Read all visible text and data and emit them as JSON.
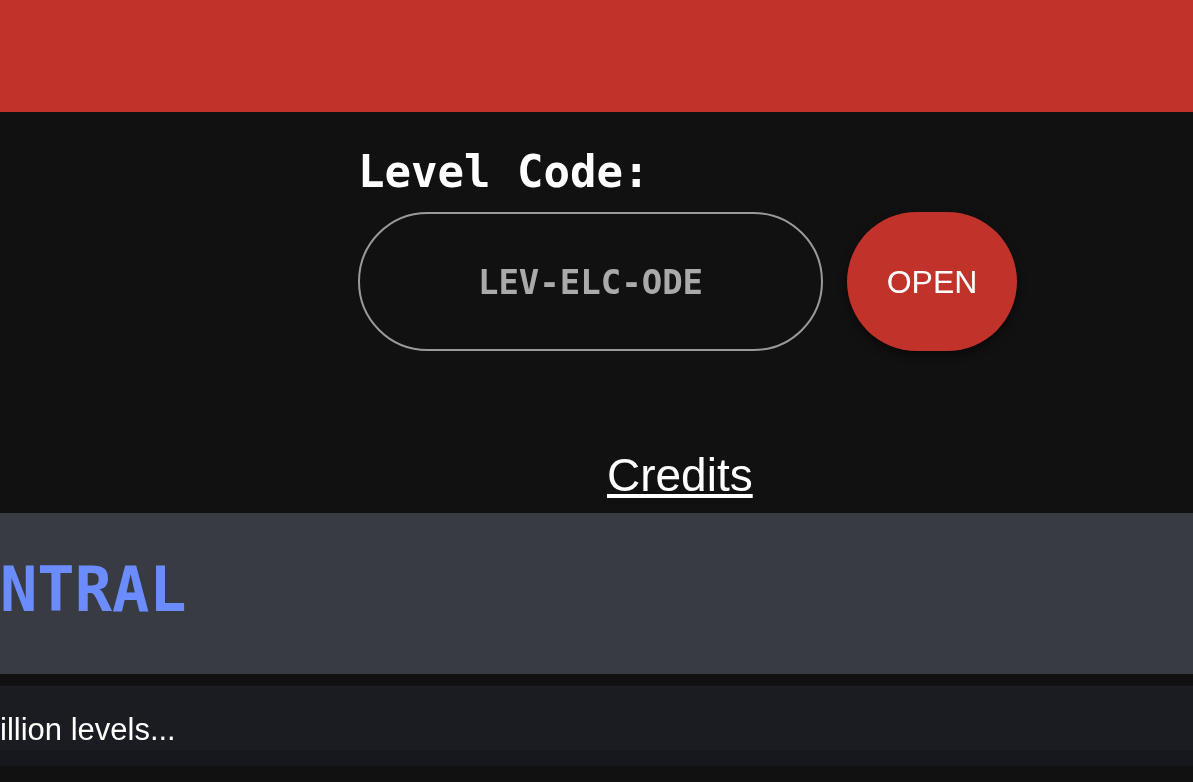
{
  "level_code": {
    "label": "Level Code:",
    "placeholder": "LEV-ELC-ODE",
    "button": "OPEN"
  },
  "credits_link": "Credits",
  "section": {
    "title": "NTRAL",
    "description": "illion levels..."
  }
}
